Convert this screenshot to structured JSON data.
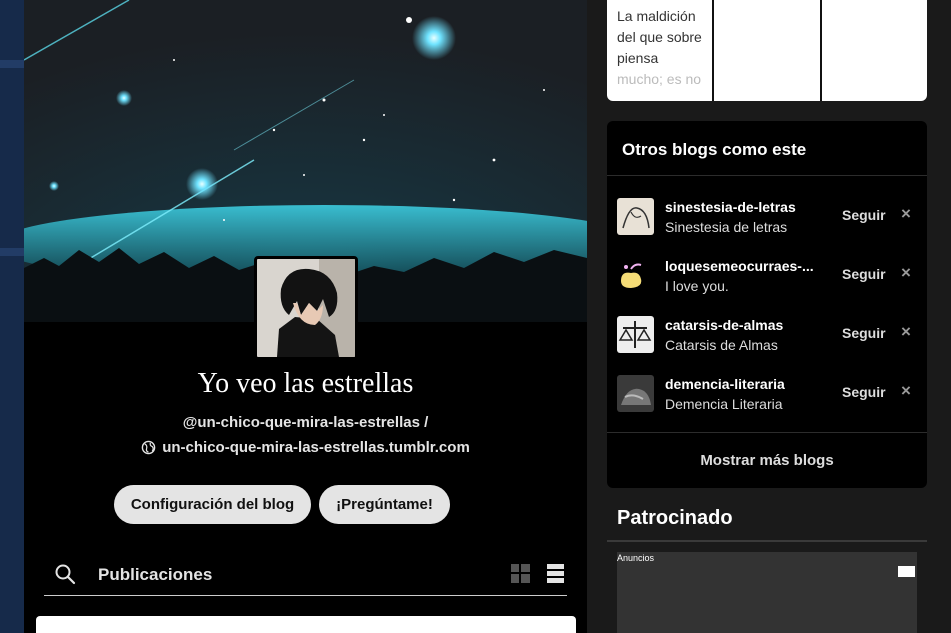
{
  "blog": {
    "title": "Yo veo las estrellas",
    "handle": "@un-chico-que-mira-las-estrellas /",
    "url": "un-chico-que-mira-las-estrellas.tumblr.com",
    "buttons": {
      "config": "Configuración del blog",
      "ask": "¡Pregúntame!"
    },
    "tabs": {
      "posts_label": "Publicaciones"
    }
  },
  "mini_panel": {
    "text_line1": "La maldición del que sobre",
    "text_line2": "piensa",
    "text_fade": "mucho; es no"
  },
  "recommendations": {
    "title": "Otros blogs como este",
    "follow_label": "Seguir",
    "dismiss_label": "×",
    "items": [
      {
        "name": "sinestesia-de-letras",
        "subtitle": "Sinestesia de letras"
      },
      {
        "name": "loquesemeocurraes-...",
        "subtitle": "I love you."
      },
      {
        "name": "catarsis-de-almas",
        "subtitle": "Catarsis de Almas"
      },
      {
        "name": "demencia-literaria",
        "subtitle": "Demencia Literaria"
      }
    ],
    "show_more": "Mostrar más blogs"
  },
  "sponsored": {
    "title": "Patrocinado",
    "ad_label": "Anuncios"
  },
  "icons": {
    "search": "search-icon",
    "globe": "globe-icon",
    "more": "more-icon",
    "grid": "grid-view-icon",
    "list": "list-view-icon",
    "close": "close-icon"
  }
}
